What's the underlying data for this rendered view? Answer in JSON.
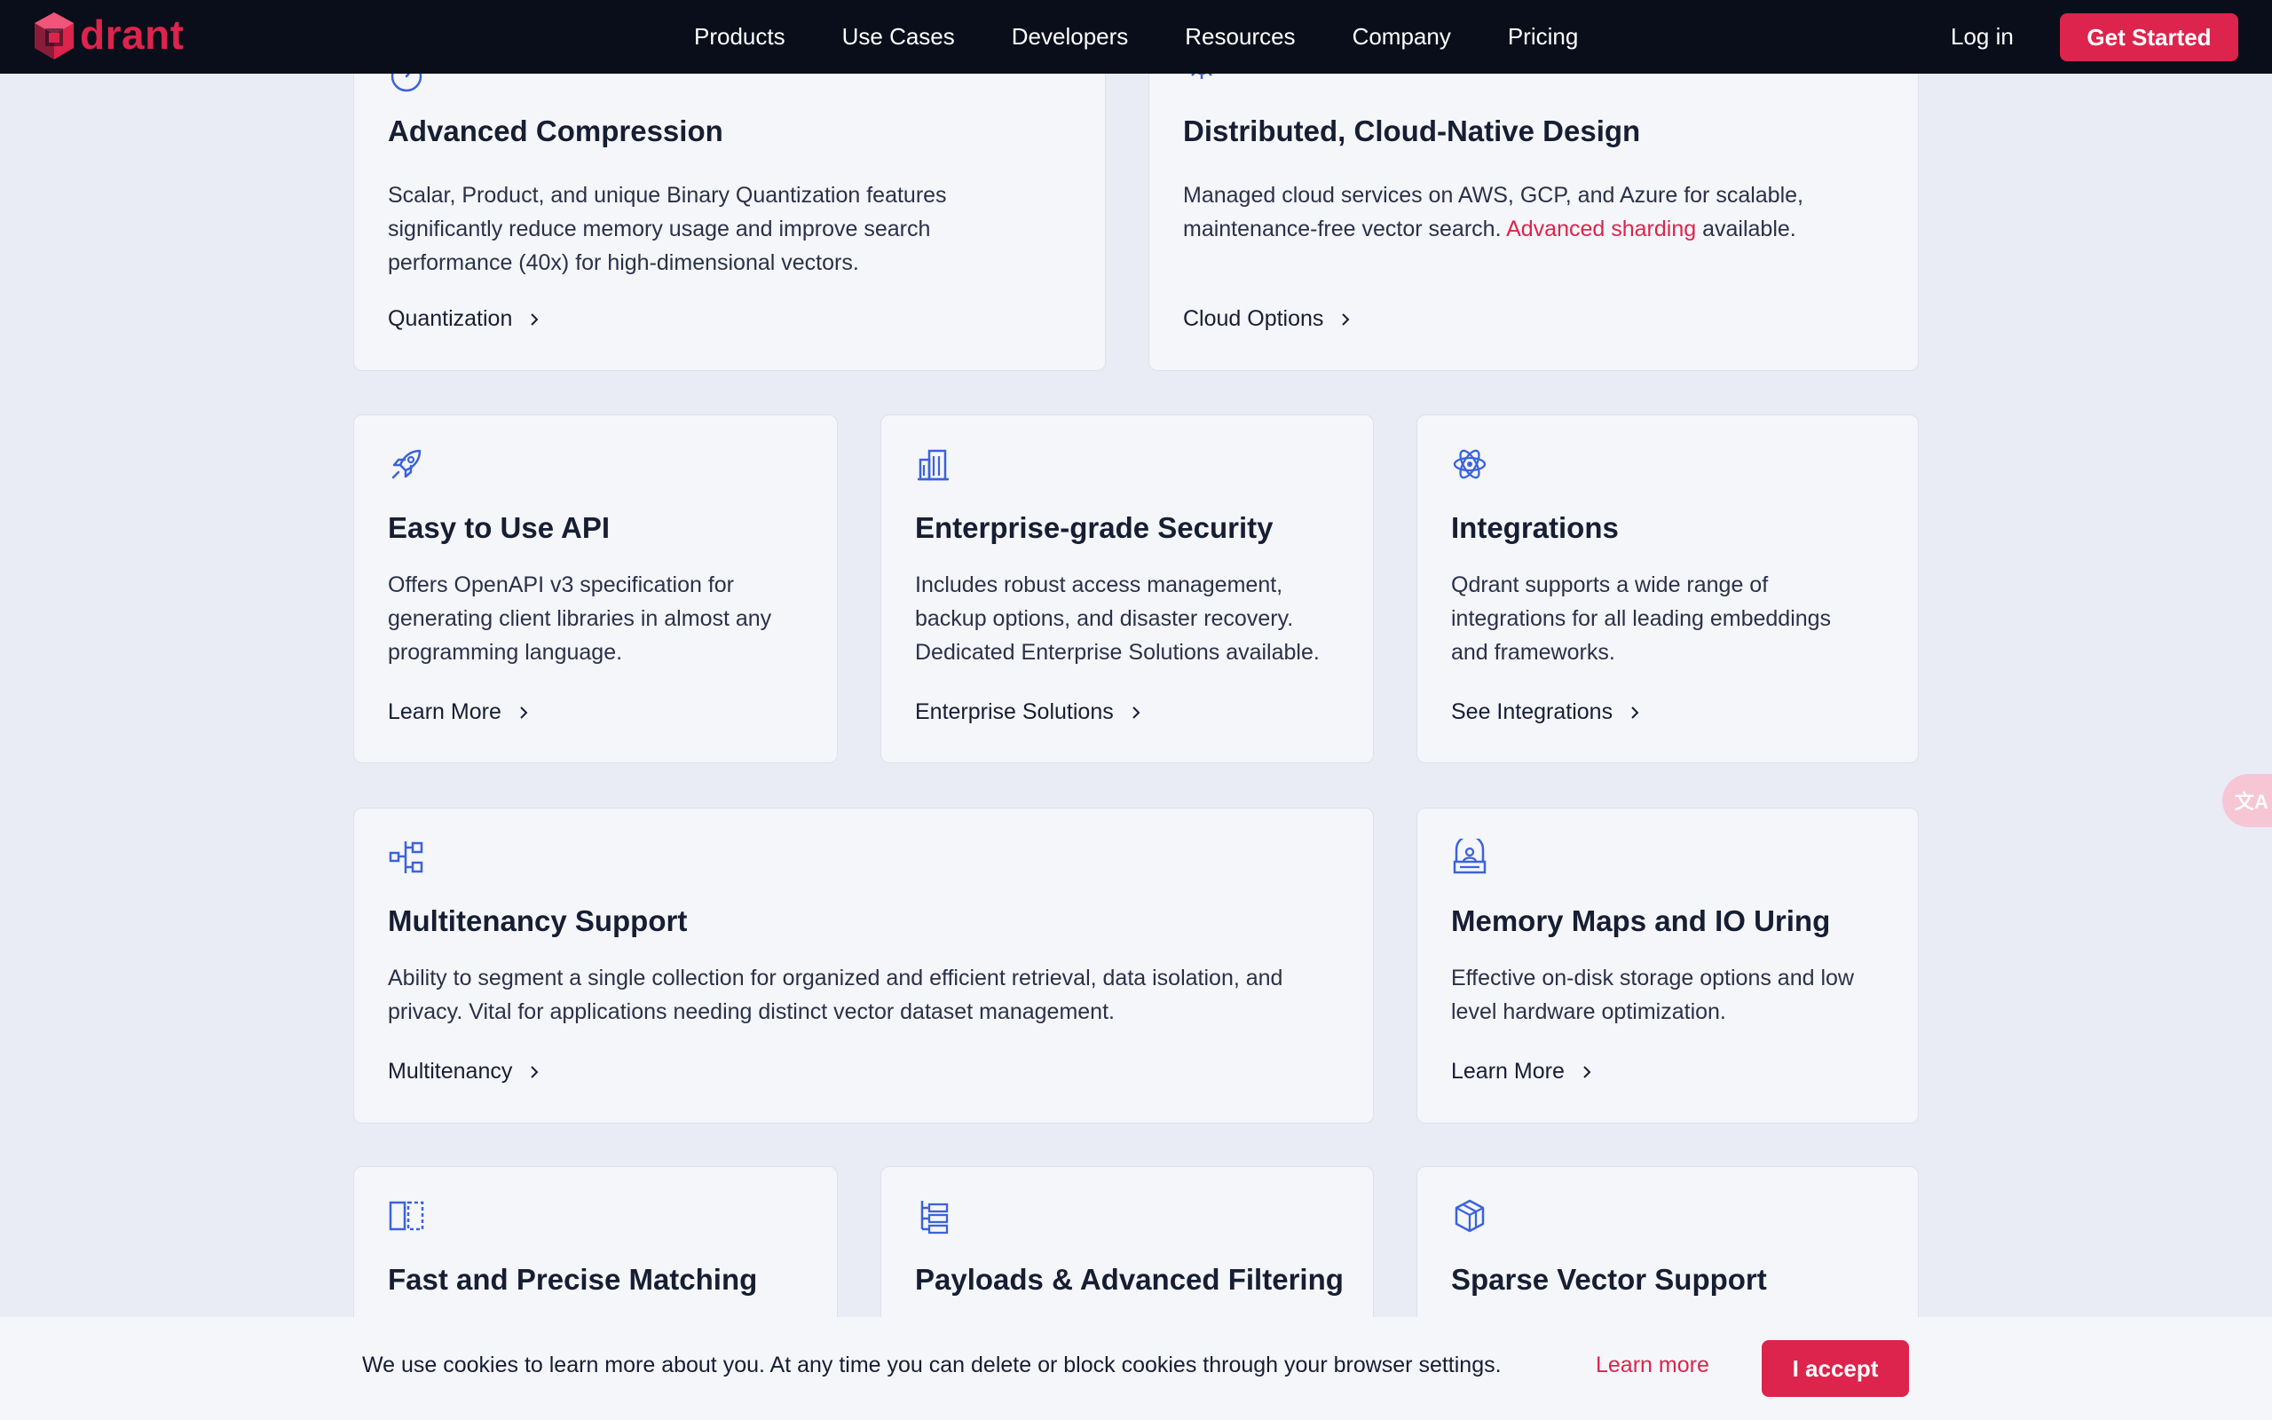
{
  "nav": {
    "brand": "drant",
    "items": [
      "Products",
      "Use Cases",
      "Developers",
      "Resources",
      "Company",
      "Pricing"
    ],
    "login": "Log in",
    "cta": "Get Started"
  },
  "cards": {
    "compression": {
      "title": "Advanced Compression",
      "desc_lines": [
        "Scalar, Product, and unique Binary Quantization features",
        "significantly reduce memory usage and improve search",
        "performance (40x) for high-dimensional vectors."
      ],
      "link": "Quantization"
    },
    "distributed": {
      "title": "Distributed, Cloud-Native Design",
      "desc_line1": "Managed cloud services on AWS, GCP, and Azure for scalable,",
      "desc_line2_pre": "maintenance-free vector search.",
      "desc_line2_link": "Advanced sharding",
      "desc_line2_post": "available.",
      "link": "Cloud Options"
    },
    "api": {
      "title": "Easy to Use API",
      "desc_lines": [
        "Offers OpenAPI v3 specification for",
        "generating client libraries in almost any",
        "programming language."
      ],
      "link": "Learn More"
    },
    "security": {
      "title": "Enterprise-grade Security",
      "desc_lines": [
        "Includes robust access management,",
        "backup options, and disaster recovery.",
        "Dedicated Enterprise Solutions available."
      ],
      "link": "Enterprise Solutions"
    },
    "integrations": {
      "title": "Integrations",
      "desc_lines": [
        "Qdrant supports a wide range of",
        "integrations for all leading embeddings",
        "and frameworks."
      ],
      "link": "See Integrations"
    },
    "multitenancy": {
      "title": "Multitenancy Support",
      "desc_lines": [
        "Ability to segment a single collection for organized and efficient retrieval, data isolation, and",
        "privacy. Vital for applications needing distinct vector dataset management."
      ],
      "link": "Multitenancy"
    },
    "memmaps": {
      "title": "Memory Maps and IO Uring",
      "desc_lines": [
        "Effective on-disk storage options and low",
        "level hardware optimization."
      ],
      "link": "Learn More"
    },
    "matching": {
      "title": "Fast and Precise Matching"
    },
    "payloads": {
      "title": "Payloads & Advanced Filtering"
    },
    "sparse": {
      "title": "Sparse Vector Support"
    }
  },
  "cookie": {
    "text": "We use cookies to learn more about you. At any time you can delete or block cookies through your browser settings.",
    "learn_more": "Learn more",
    "accept": "I accept"
  },
  "translate_button": "文A",
  "colors": {
    "brand_red": "#dc244c",
    "nav_bg": "#090e1a",
    "page_bg": "#e9ecf4",
    "card_bg": "#f5f6fa",
    "icon_blue": "#3b63d9"
  },
  "icons": {
    "compression": "gauge-icon",
    "distributed": "cloud-gear-icon",
    "api": "rocket-icon",
    "security": "building-icon",
    "integrations": "atom-icon",
    "multitenancy": "hierarchy-icon",
    "memmaps": "storage-icon",
    "matching": "split-box-icon",
    "payloads": "tree-list-icon",
    "sparse": "cubes-icon",
    "link_arrow": "chevron-right-icon"
  }
}
